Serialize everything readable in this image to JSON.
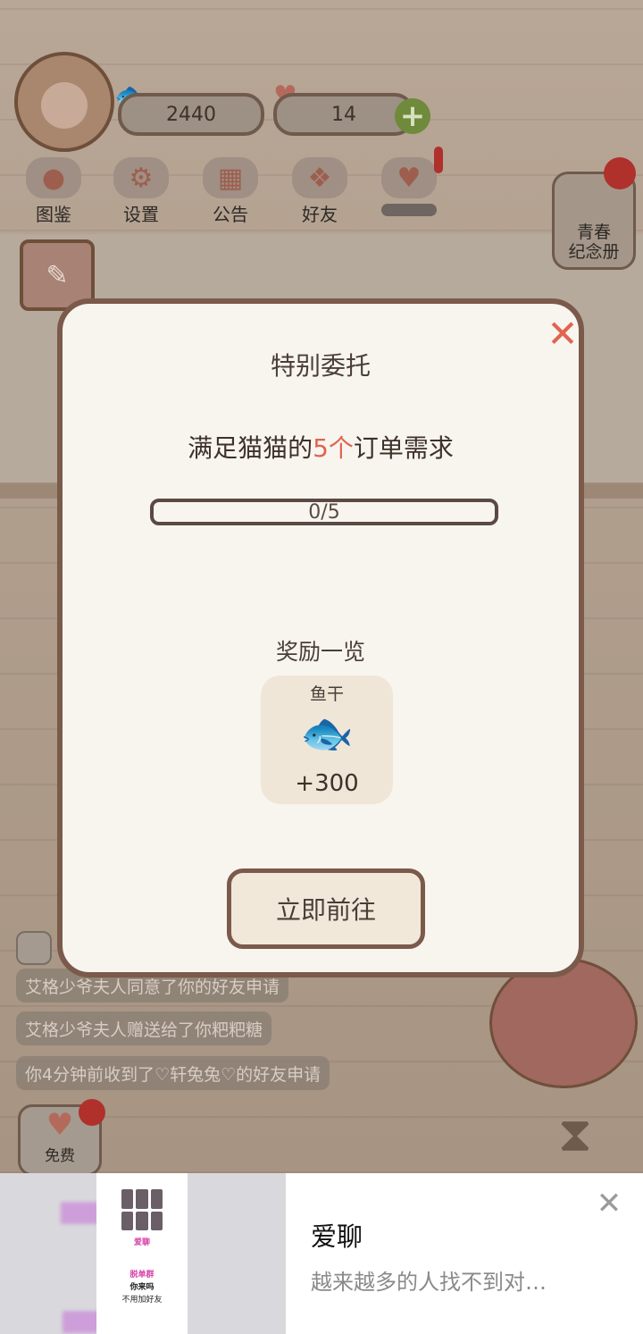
{
  "hud": {
    "fish_count": "2440",
    "heart_count": "14",
    "plus": "+"
  },
  "menu": [
    {
      "label": "图鉴",
      "icon": "cat-face-icon"
    },
    {
      "label": "设置",
      "icon": "gear-icon"
    },
    {
      "label": "公告",
      "icon": "gift-icon"
    },
    {
      "label": "好友",
      "icon": "friends-icon"
    },
    {
      "label": "",
      "icon": "hearts-icon"
    }
  ],
  "yearbook": {
    "line1": "青春",
    "line2": "纪念册"
  },
  "chat": [
    "艾格少爷夫人同意了你的好友申请",
    "艾格少爷夫人赠送给了你粑粑糖",
    "你4分钟前收到了♡轩兔兔♡的好友申请"
  ],
  "free_button": {
    "label": "免费"
  },
  "modal": {
    "title": "特别委托",
    "task_prefix": "满足猫猫的",
    "task_highlight": "5个",
    "task_suffix": "订单需求",
    "progress_text": "0/5",
    "progress_fraction": 0,
    "reward_heading": "奖励一览",
    "reward_name": "鱼干",
    "reward_amount": "+300",
    "go_label": "立即前往"
  },
  "ad": {
    "title": "爱聊",
    "description": "越来越多的人找不到对…",
    "poster_brand": "爱聊",
    "poster_line1": "脱单群",
    "poster_line2": "你来吗",
    "poster_line3": "不用加好友"
  },
  "colors": {
    "accent_red": "#e06450",
    "modal_border": "#7b5a4b",
    "modal_bg": "#f8f5ef"
  }
}
